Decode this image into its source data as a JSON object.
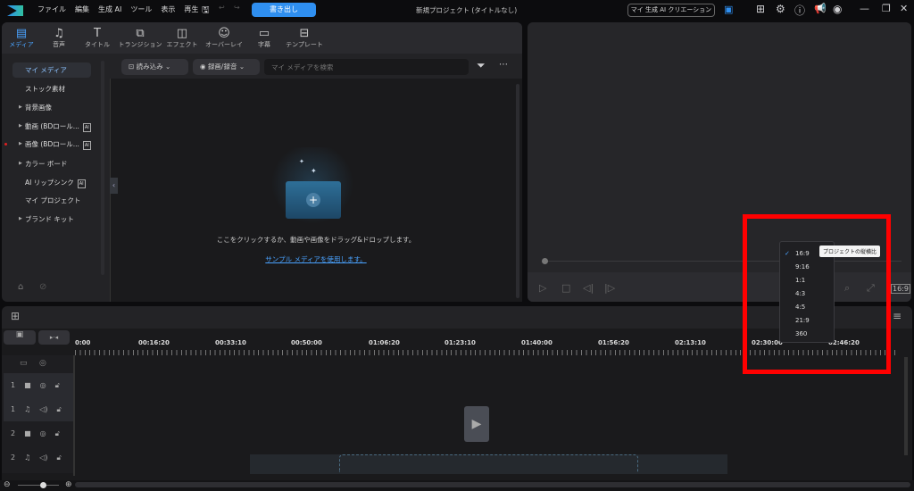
{
  "titlebar": {
    "menu": [
      "ファイル",
      "編集",
      "生成 AI",
      "ツール",
      "表示",
      "再生"
    ],
    "export_label": "書き出し",
    "project_title": "新規プロジェクト (タイトルなし)",
    "ai_creation_label": "マイ 生成 AI クリエーション"
  },
  "tabs": [
    {
      "label": "メディア",
      "icon": "media-icon"
    },
    {
      "label": "音声",
      "icon": "music-icon"
    },
    {
      "label": "タイトル",
      "icon": "title-icon"
    },
    {
      "label": "トランジション",
      "icon": "transition-icon"
    },
    {
      "label": "エフェクト",
      "icon": "effect-icon"
    },
    {
      "label": "オーバーレイ",
      "icon": "overlay-icon"
    },
    {
      "label": "字幕",
      "icon": "subtitle-icon"
    },
    {
      "label": "テンプレート",
      "icon": "template-icon"
    }
  ],
  "sidebar": {
    "items": [
      {
        "label": "マイ メディア"
      },
      {
        "label": "ストック素材"
      },
      {
        "label": "背景画像"
      },
      {
        "label": "動画 (BDロール..."
      },
      {
        "label": "画像 (BDロール..."
      },
      {
        "label": "カラー ボード"
      },
      {
        "label": "AI リップシンク"
      },
      {
        "label": "マイ プロジェクト"
      },
      {
        "label": "ブランド キット"
      }
    ],
    "ai_badge": "AI"
  },
  "media": {
    "import_label": "読み込み",
    "record_label": "録画/録音",
    "search_placeholder": "マイ メディアを検索",
    "empty_text": "ここをクリックするか、動画や画像をドラッグ&ドロップします。",
    "sample_link": "サンプル メディアを使用します。"
  },
  "timeline": {
    "ruler": [
      "0:00",
      "00:16:20",
      "00:33:10",
      "00:50:00",
      "01:06:20",
      "01:23:10",
      "01:40:00",
      "01:56:20",
      "02:13:10",
      "02:30:00",
      "02:46:20"
    ],
    "tracks": [
      {
        "num": "1",
        "type": "video"
      },
      {
        "num": "1",
        "type": "audio"
      },
      {
        "num": "2",
        "type": "video"
      },
      {
        "num": "2",
        "type": "audio"
      }
    ]
  },
  "aspect_dropdown": {
    "options": [
      "16:9",
      "9:16",
      "1:1",
      "4:3",
      "4:5",
      "21:9",
      "360"
    ],
    "selected": "16:9",
    "tooltip": "プロジェクトの縦横比"
  },
  "colors": {
    "accent": "#2f8ff0",
    "highlight": "#ff0000"
  }
}
